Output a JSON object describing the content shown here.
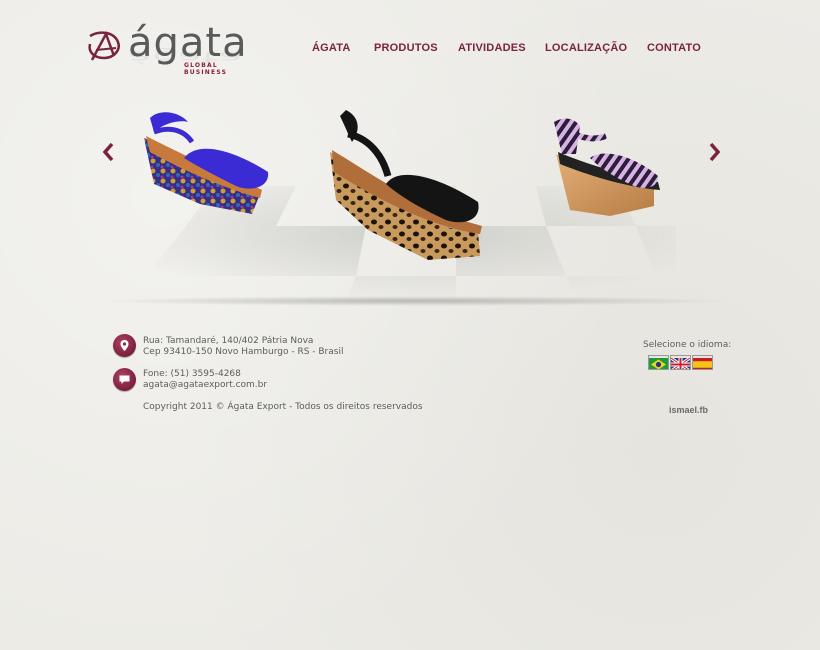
{
  "brand": {
    "name": "ágata",
    "tagline": "GLOBAL BUSINESS"
  },
  "nav": [
    {
      "label": "ÁGATA"
    },
    {
      "label": "PRODUTOS"
    },
    {
      "label": "ATIVIDADES"
    },
    {
      "label": "LOCALIZAÇÃO"
    },
    {
      "label": "CONTATO"
    }
  ],
  "carousel": {
    "prev_icon": "chevron-left-icon",
    "next_icon": "chevron-right-icon",
    "items": [
      {
        "name": "blue-snakeskin-wedge-sandal"
      },
      {
        "name": "black-leopard-wedge-sandal"
      },
      {
        "name": "striped-cork-wedge-sandal"
      }
    ]
  },
  "contact": {
    "address_line1": "Rua: Tamandaré, 140/402 Pátria Nova",
    "address_line2": "Cep 93410-150 Novo Hamburgo - RS - Brasil",
    "phone": "Fone: (51) 3595-4268",
    "email": "agata@agataexport.com.br",
    "copyright": "Copyright 2011 © Ágata Export - Todos os direitos reservados"
  },
  "language": {
    "label": "Selecione o idioma:",
    "flags": [
      "brazil-flag-icon",
      "uk-flag-icon",
      "spain-flag-icon"
    ]
  },
  "credit": "ismael.fb",
  "colors": {
    "accent": "#7a2340",
    "text": "#5d5d5d",
    "background": "#ecebe6"
  }
}
